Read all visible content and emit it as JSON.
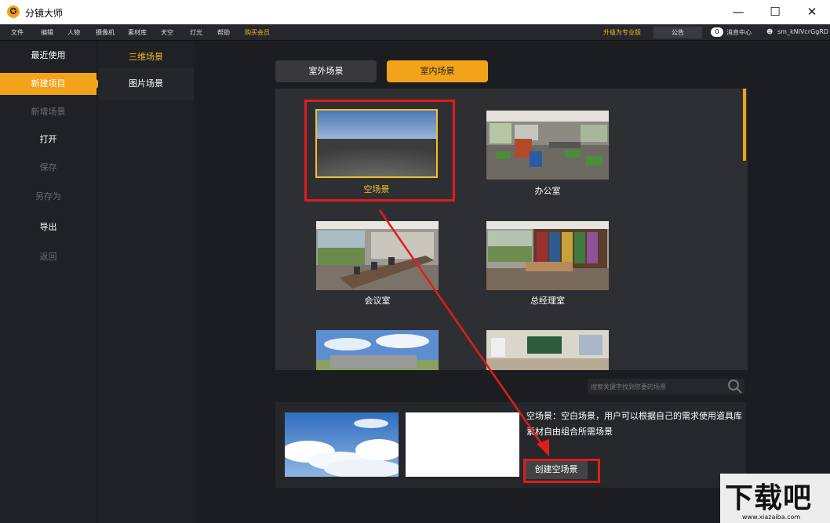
{
  "app": {
    "title": "分镜大师",
    "minimize": "—",
    "maximize": "☐",
    "close": "✕"
  },
  "menu": {
    "items": [
      "文件",
      "编辑",
      "人物",
      "摄像机",
      "素材库",
      "天空",
      "灯光",
      "帮助"
    ],
    "buy": "购买会员",
    "upgrade": "升级为专业版",
    "notice": "公告",
    "msg_count": "0",
    "messages": "消息中心",
    "user": "sm_kNIVcrGgRD"
  },
  "sidebar": {
    "items": [
      {
        "label": "最近使用",
        "state": "normal"
      },
      {
        "label": "新建项目",
        "state": "active"
      },
      {
        "label": "新增场景",
        "state": "disabled"
      },
      {
        "label": "打开",
        "state": "normal"
      },
      {
        "label": "保存",
        "state": "disabled"
      },
      {
        "label": "另存为",
        "state": "disabled"
      },
      {
        "label": "导出",
        "state": "normal"
      },
      {
        "label": "返回",
        "state": "disabled"
      }
    ]
  },
  "subnav": {
    "items": [
      {
        "label": "三维场景",
        "active": true
      },
      {
        "label": "图片场景",
        "active": false
      }
    ]
  },
  "tabs": {
    "outdoor": "室外场景",
    "indoor": "室内场景"
  },
  "scenes": [
    {
      "label": "空场景",
      "selected": true
    },
    {
      "label": "办公室",
      "selected": false
    },
    {
      "label": "会议室",
      "selected": false
    },
    {
      "label": "总经理室",
      "selected": false
    },
    {
      "label": "",
      "selected": false
    },
    {
      "label": "",
      "selected": false
    }
  ],
  "search": {
    "placeholder": "搜索关键字找到您要的场景"
  },
  "detail": {
    "description": "空场景：空白场景，用户可以根据自己的需求使用道具库素材自由组合所需场景",
    "create_button": "创建空场景"
  },
  "watermark": {
    "text": "下载吧",
    "url": "www.xiazaiba.com"
  },
  "colors": {
    "accent": "#f2a31a",
    "highlight": "#e21c1c"
  }
}
